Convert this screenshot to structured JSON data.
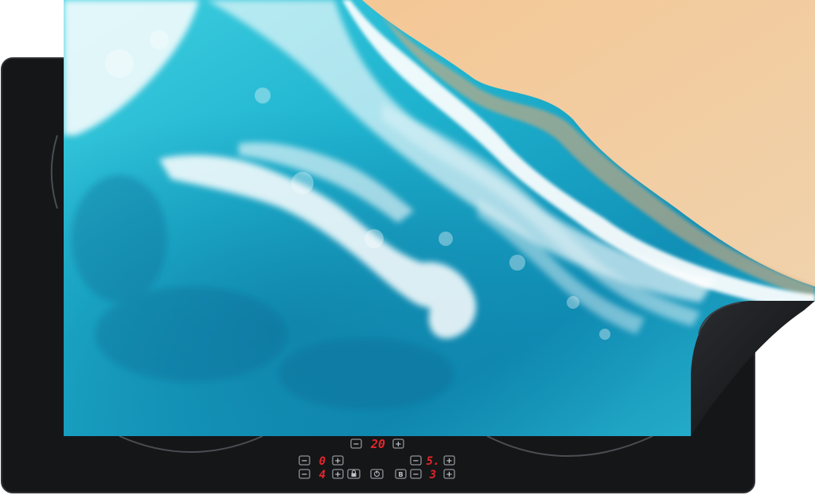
{
  "image": {
    "subject": "induction hob protector mat with aerial beach and ocean waves print",
    "colors": {
      "hob_black": "#151618",
      "ocean_deep": "#0f8fb3",
      "ocean_turquoise": "#2cc3d6",
      "foam": "#ffffff",
      "sand": "#f2c897",
      "display_red": "#e3262b"
    }
  },
  "controls": {
    "timer": {
      "minus": "−",
      "value": "20",
      "plus": "+"
    },
    "zone_front_left": {
      "minus": "−",
      "value": "0",
      "plus": "+"
    },
    "zone_front_right": {
      "minus": "−",
      "value": "5.",
      "plus": "+"
    },
    "zone_rear_left": {
      "minus": "−",
      "value": "4",
      "plus": "+",
      "lock_icon": "lock-icon"
    },
    "power_icon": "power-icon",
    "zone_rear_right": {
      "minus": "−",
      "value": "3",
      "plus": "+",
      "boost_label": "B"
    }
  }
}
